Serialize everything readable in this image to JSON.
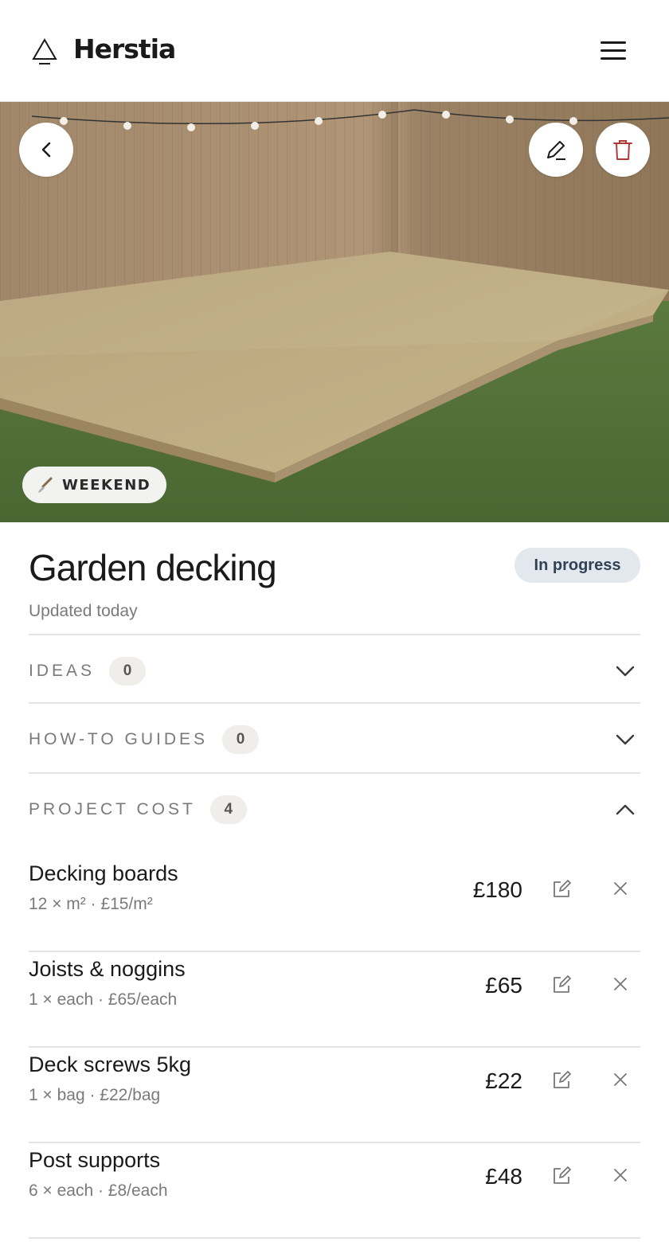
{
  "header": {
    "brand": "Herstia",
    "logo_icon": "triangle-logo-icon",
    "menu_icon": "hamburger-menu-icon"
  },
  "hero": {
    "image_alt": "wooden garden decking on grass with fence",
    "back_icon": "chevron-left-icon",
    "edit_icon": "pencil-icon",
    "delete_icon": "trash-icon",
    "badge": {
      "icon": "paintbrush-icon",
      "label": "WEEKEND"
    }
  },
  "project": {
    "title": "Garden decking",
    "updated": "Updated today",
    "status": "In progress"
  },
  "sections": {
    "ideas": {
      "label": "IDEAS",
      "count": "0",
      "expanded": false
    },
    "guides": {
      "label": "HOW-TO GUIDES",
      "count": "0",
      "expanded": false
    },
    "cost": {
      "label": "PROJECT COST",
      "count": "4",
      "expanded": true
    }
  },
  "cost_items": [
    {
      "name": "Decking boards",
      "detail": "12 × m² · £15/m²",
      "price": "£180"
    },
    {
      "name": "Joists & noggins",
      "detail": "1 × each · £65/each",
      "price": "£65"
    },
    {
      "name": "Deck screws 5kg",
      "detail": "1 × bag · £22/bag",
      "price": "£22"
    },
    {
      "name": "Post supports",
      "detail": "6 × each · £8/each",
      "price": "£48"
    }
  ],
  "colors": {
    "delete_accent": "#b03a3a",
    "status_bg": "#e3e8ee",
    "status_text": "#304256",
    "count_bg": "#f0eeea"
  }
}
